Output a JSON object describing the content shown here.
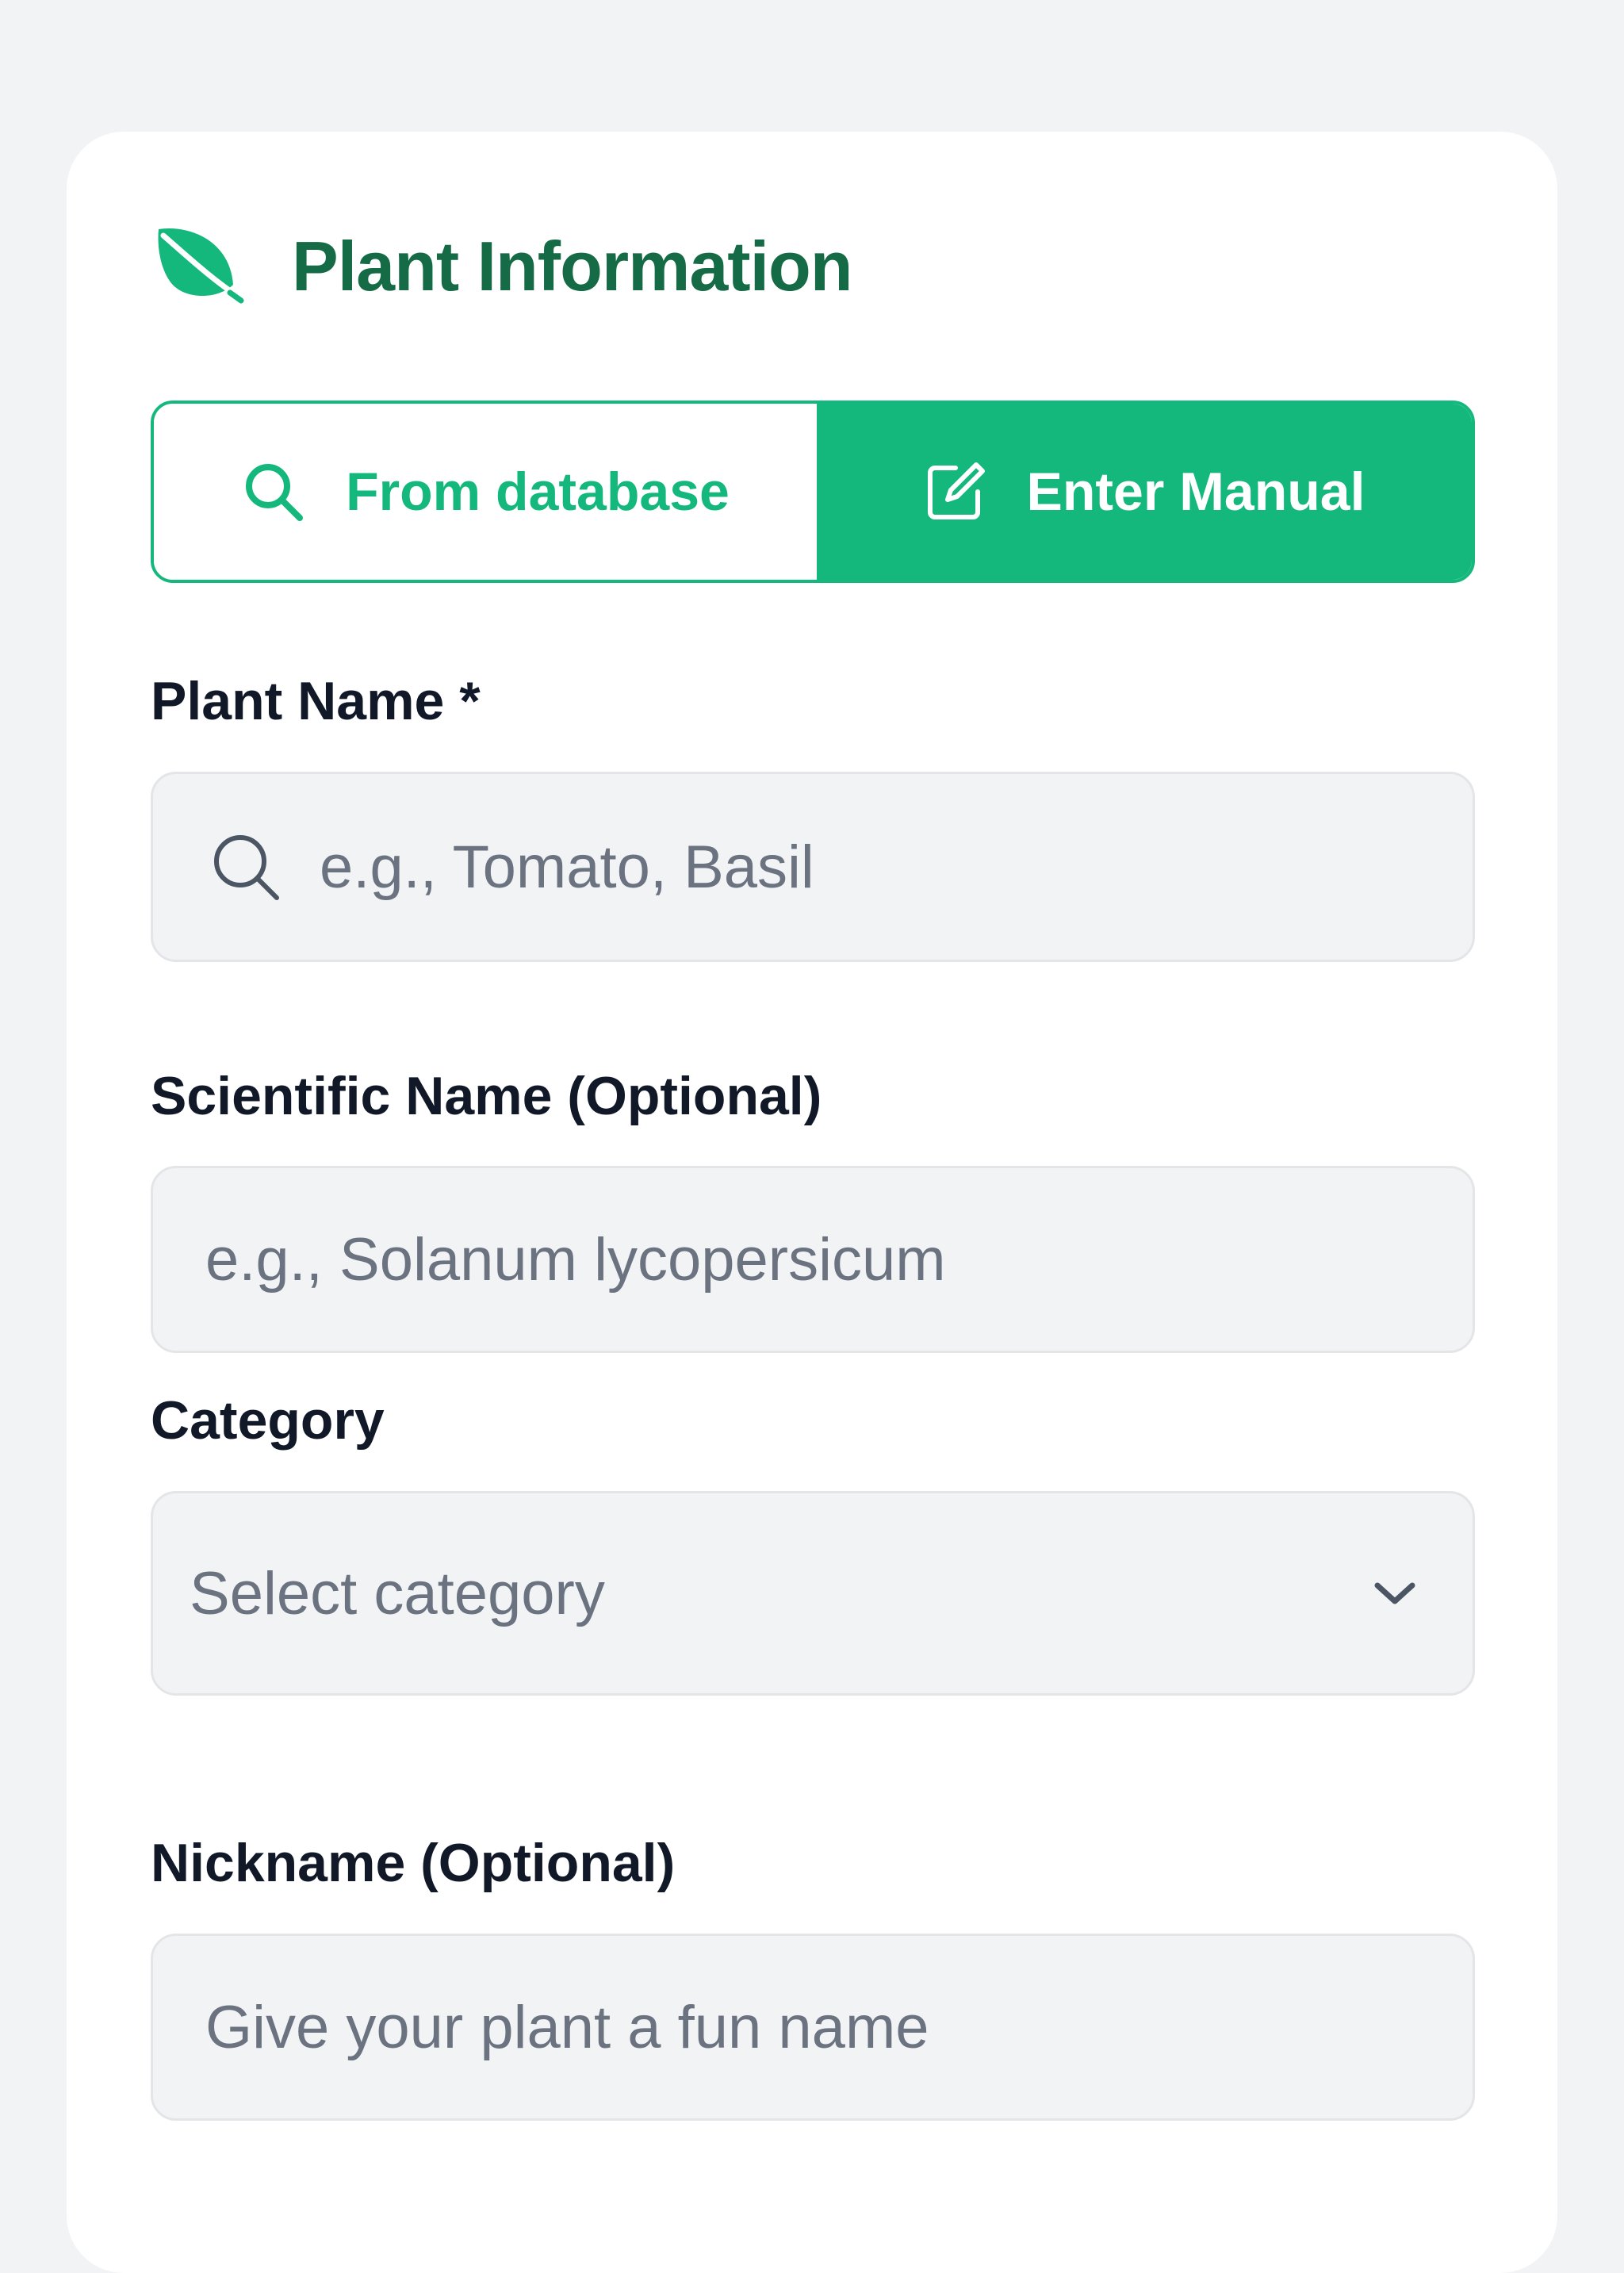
{
  "header": {
    "icon": "leaf-icon",
    "title": "Plant Information"
  },
  "source_toggle": {
    "options": [
      {
        "label": "From database",
        "icon": "search-icon",
        "selected": false
      },
      {
        "label": "Enter Manual",
        "icon": "edit-icon",
        "selected": true
      }
    ]
  },
  "form": {
    "plant_name": {
      "label": "Plant Name *",
      "placeholder": "e.g., Tomato, Basil",
      "icon": "search-icon"
    },
    "scientific_name": {
      "label": "Scientific Name (Optional)",
      "placeholder": "e.g., Solanum lycopersicum"
    },
    "category": {
      "label": "Category",
      "selected": "Select category",
      "icon": "chevron-down-icon"
    },
    "nickname": {
      "label": "Nickname (Optional)",
      "placeholder": "Give your plant a fun name"
    }
  },
  "colors": {
    "accent": "#14b87d",
    "title_green": "#166b47",
    "background": "#f2f3f5",
    "field_background": "#f2f3f5",
    "label_text": "#111827",
    "placeholder_text": "#6b7280"
  }
}
